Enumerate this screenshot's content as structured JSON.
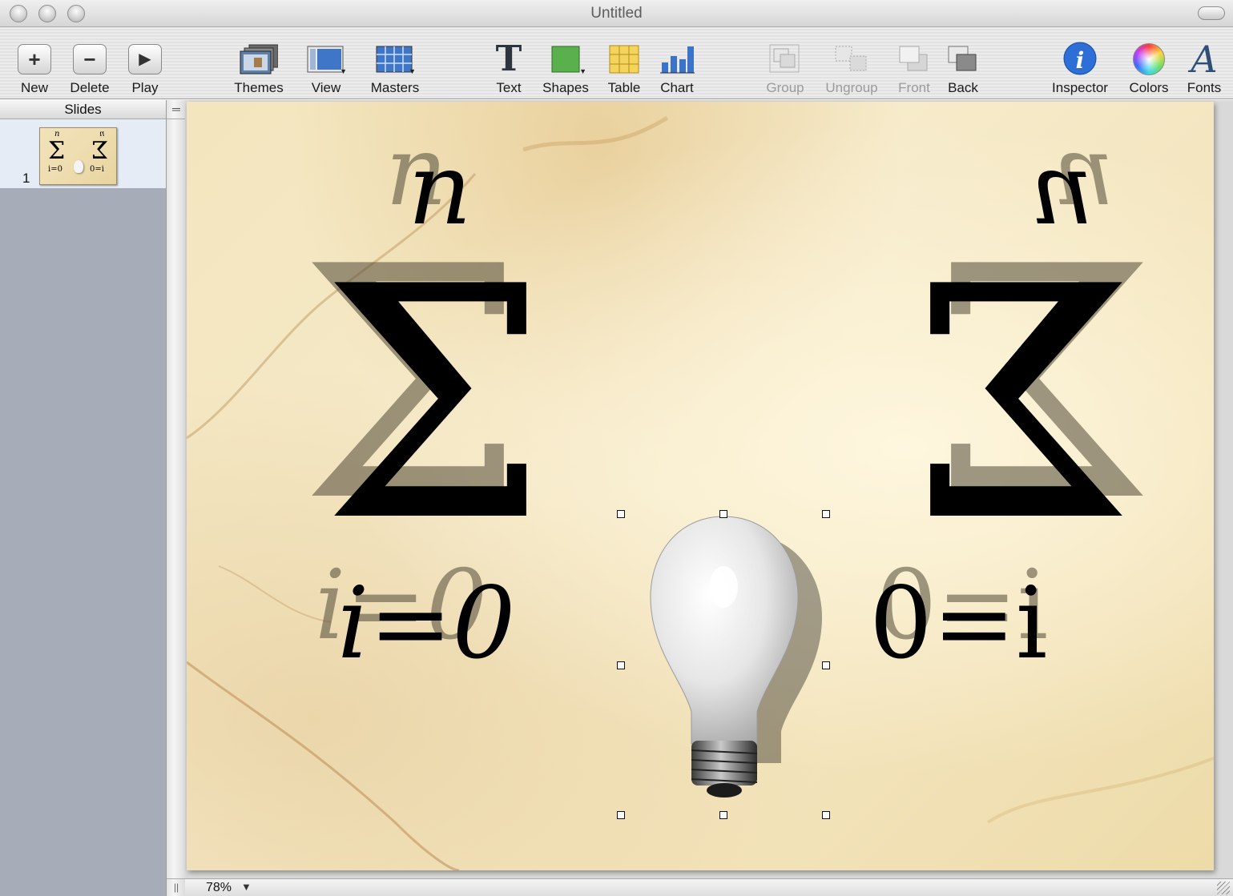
{
  "window": {
    "title": "Untitled"
  },
  "toolbar": {
    "new": "New",
    "delete": "Delete",
    "play": "Play",
    "themes": "Themes",
    "view": "View",
    "masters": "Masters",
    "text": "Text",
    "shapes": "Shapes",
    "table": "Table",
    "chart": "Chart",
    "group": "Group",
    "ungroup": "Ungroup",
    "front": "Front",
    "back": "Back",
    "inspector": "Inspector",
    "colors": "Colors",
    "fonts": "Fonts"
  },
  "sidebar": {
    "header": "Slides",
    "slides": [
      {
        "number": "1"
      }
    ]
  },
  "slide": {
    "left_upper": "n",
    "left_sigma": "Σ",
    "left_lower": "i=0",
    "right_upper": "n",
    "right_sigma": "Σ",
    "right_lower": "0=i"
  },
  "status": {
    "zoom": "78%"
  },
  "colors": {
    "slide_bg": "#f3e5bd",
    "sidebar": "#a6adb9",
    "selected_slide": "#e6ecf6"
  }
}
